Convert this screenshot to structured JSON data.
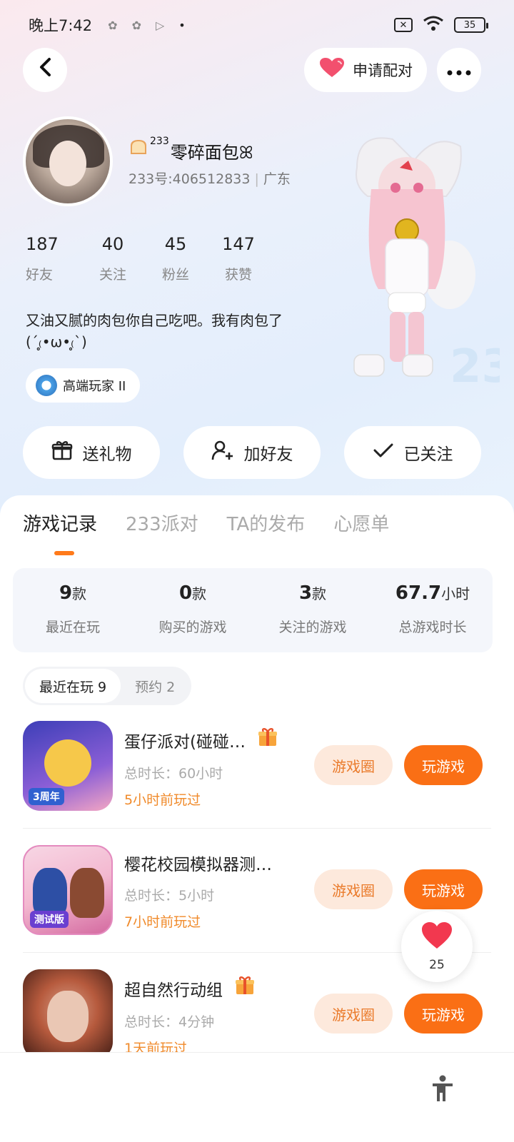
{
  "status_bar": {
    "time": "晚上7:42",
    "battery": "35"
  },
  "header": {
    "pair_label": "申请配对"
  },
  "profile": {
    "nickname": "零碎面包ꕤ",
    "nickname_prefix": "233",
    "uid": "233号:406512833",
    "region": "广东",
    "stats": [
      {
        "num": "187",
        "label": "好友"
      },
      {
        "num": "40",
        "label": "关注"
      },
      {
        "num": "45",
        "label": "粉丝"
      },
      {
        "num": "147",
        "label": "获赞"
      }
    ],
    "bio": "又油又腻的肉包你自己吃吧。我有肉包了(ˊ₍̥•ω•₍̥ˋ)",
    "badge": "高端玩家 II"
  },
  "actions": {
    "gift": "送礼物",
    "add_friend": "加好友",
    "followed": "已关注"
  },
  "tabs": [
    "游戏记录",
    "233派对",
    "TA的发布",
    "心愿单"
  ],
  "summary": [
    {
      "num": "9",
      "unit": "款",
      "label": "最近在玩"
    },
    {
      "num": "0",
      "unit": "款",
      "label": "购买的游戏"
    },
    {
      "num": "3",
      "unit": "款",
      "label": "关注的游戏"
    },
    {
      "num": "67.7",
      "unit": "小时",
      "label": "总游戏时长"
    }
  ],
  "segments": {
    "recent": "最近在玩 9",
    "reserve": "预约 2"
  },
  "games": [
    {
      "title": "蛋仔派对(碰碰…",
      "duration": "总时长：60小时",
      "last": "5小时前玩过",
      "circle": "游戏圈",
      "play": "玩游戏",
      "icon_tag": "3周年"
    },
    {
      "title": "樱花校园模拟器测…",
      "duration": "总时长：5小时",
      "last": "7小时前玩过",
      "circle": "游戏圈",
      "play": "玩游戏",
      "icon_tag": "测试版"
    },
    {
      "title": "超自然行动组",
      "duration": "总时长：4分钟",
      "last": "1天前玩过",
      "circle": "游戏圈",
      "play": "玩游戏"
    }
  ],
  "like": {
    "count": "25"
  },
  "colors": {
    "accent": "#fa6f15",
    "heart": "#f2384f"
  }
}
